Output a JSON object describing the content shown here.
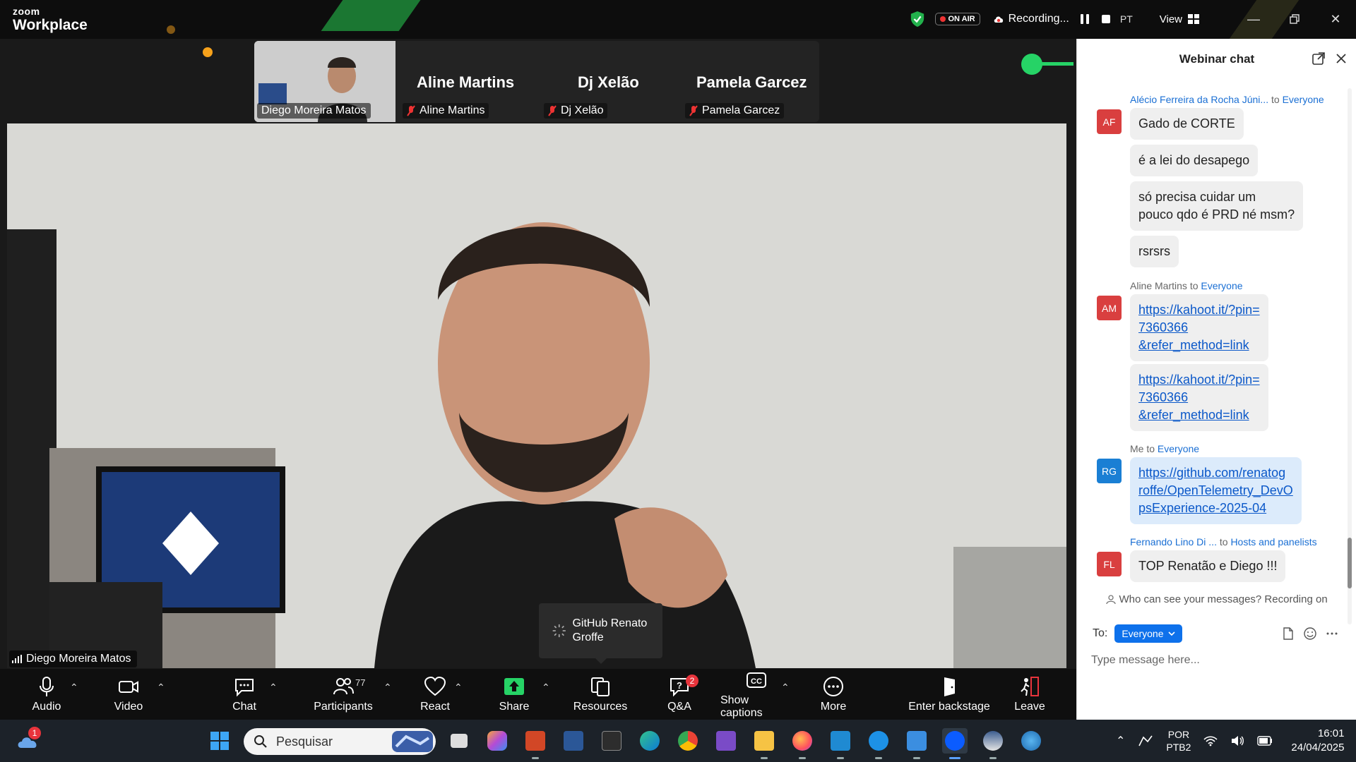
{
  "app": {
    "logo_small": "zoom",
    "logo_big": "Workplace"
  },
  "titlebar": {
    "on_air": "ON AIR",
    "recording_label": "Recording...",
    "pt_label": "PT",
    "view_label": "View"
  },
  "gallery": {
    "tiles": [
      {
        "name": "Diego Moreira Matos"
      },
      {
        "name": "Aline Martins",
        "big": "Aline Martins"
      },
      {
        "name": "Dj Xelão",
        "big": "Dj Xelão"
      },
      {
        "name": "Pamela Garcez",
        "big": "Pamela Garcez"
      }
    ]
  },
  "main_video": {
    "speaker": "Diego Moreira Matos",
    "tooltip": "GitHub Renato Groffe"
  },
  "toolbar": {
    "audio": "Audio",
    "video": "Video",
    "chat": "Chat",
    "participants": "Participants",
    "participants_count": "77",
    "react": "React",
    "share": "Share",
    "resources": "Resources",
    "qa": "Q&A",
    "qa_badge": "2",
    "captions": "Show captions",
    "more": "More",
    "backstage": "Enter backstage",
    "leave": "Leave"
  },
  "chat": {
    "title": "Webinar chat",
    "messages": [
      {
        "sender": "Alécio Ferreira da Rocha Júni...",
        "to": "to",
        "group": "Everyone",
        "avatar": "AF",
        "avatar_color": "#d93f3f"
      },
      {
        "text": "Gado de CORTE"
      },
      {
        "text": "é a lei do desapego"
      },
      {
        "text_line1": "só precisa cuidar um",
        "text_line2": "pouco qdo é PRD né msm?"
      },
      {
        "text": "rsrsrs"
      },
      {
        "sender": "Aline Martins",
        "to": "to",
        "group": "Everyone",
        "avatar": "AM",
        "avatar_color": "#d93f3f"
      },
      {
        "link_line1": "https://kahoot.it/?pin=",
        "link_line2": "7360366",
        "link_line3": "&refer_method=link"
      },
      {
        "link_line1": "https://kahoot.it/?pin=",
        "link_line2": "7360366",
        "link_line3": "&refer_method=link"
      },
      {
        "sender": "Me",
        "to": "to",
        "group": "Everyone",
        "avatar": "RG",
        "avatar_color": "#1a7fd4"
      },
      {
        "link_line1": "https://github.com/renatog",
        "link_line2": "roffe/OpenTelemetry_DevO",
        "link_line3": "psExperience-2025-04"
      },
      {
        "sender": "Fernando Lino Di ...",
        "to": "to",
        "group": "Hosts and panelists",
        "avatar": "FL",
        "avatar_color": "#d93f3f"
      },
      {
        "text": "TOP Renatão e Diego !!!"
      }
    ],
    "privacy": "Who can see your messages? Recording on",
    "to_label": "To:",
    "to_value": "Everyone",
    "placeholder": "Type message here..."
  },
  "taskbar": {
    "weather_badge": "1",
    "search_placeholder": "Pesquisar",
    "lang_line1": "POR",
    "lang_line2": "PTB2",
    "time": "16:01",
    "date": "24/04/2025"
  },
  "colors": {
    "accent_blue": "#0e71eb",
    "share_green": "#26d366",
    "badge_red": "#e8343c"
  }
}
